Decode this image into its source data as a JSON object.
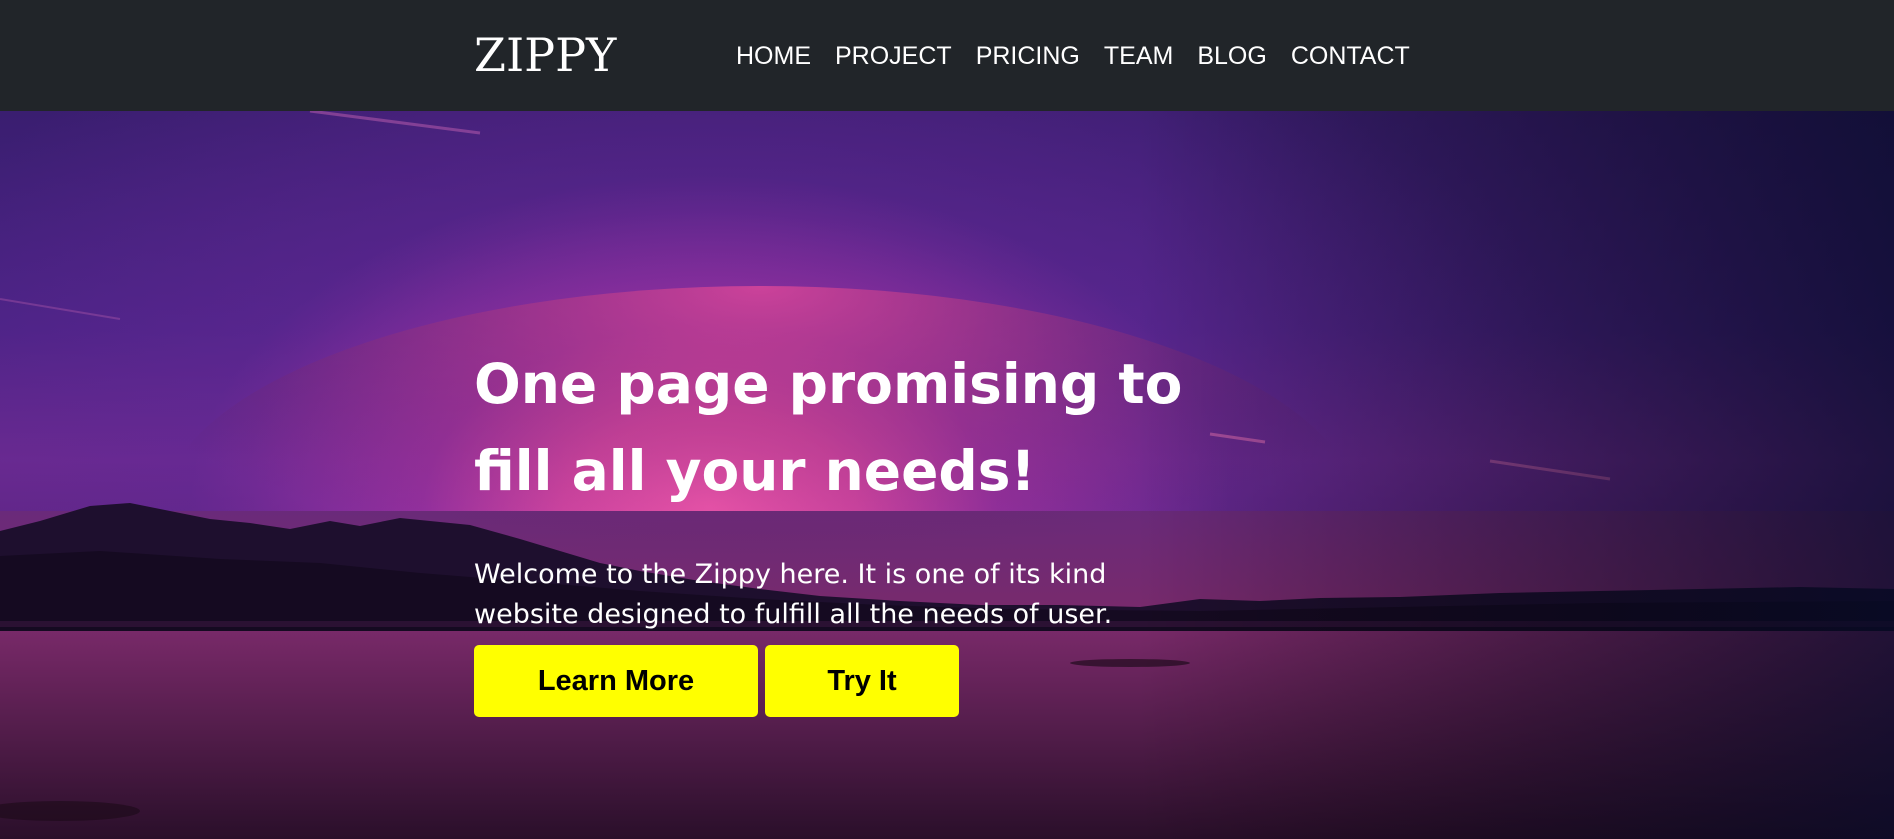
{
  "brand": {
    "logo_text": "ZIPPY"
  },
  "nav": {
    "items": [
      {
        "label": "HOME"
      },
      {
        "label": "PROJECT"
      },
      {
        "label": "PRICING"
      },
      {
        "label": "TEAM"
      },
      {
        "label": "BLOG"
      },
      {
        "label": "CONTACT"
      }
    ]
  },
  "hero": {
    "title": "One page promising to fill all your needs!",
    "subtitle": "Welcome to the Zippy here. It is one of its kind website designed to fulfill all the needs of user.",
    "primary_button_label": "Learn More",
    "secondary_button_label": "Try It",
    "background_image": "sunset-lake-mountains"
  },
  "colors": {
    "navbar": "#212529",
    "button": "#ffff00",
    "button_text": "#000000",
    "text": "#ffffff"
  }
}
